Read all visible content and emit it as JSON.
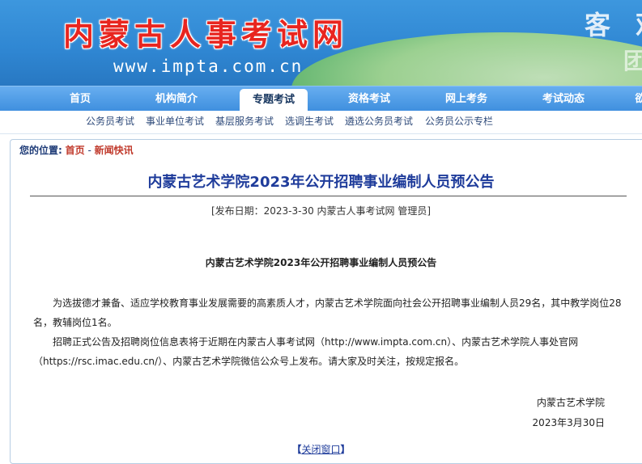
{
  "header": {
    "logo_text": "内蒙古人事考试网",
    "domain": "www.impta.com.cn",
    "slogan_line1": "客 观",
    "slogan_line2": "团"
  },
  "nav": {
    "items": [
      {
        "label": "首页",
        "active": false
      },
      {
        "label": "机构简介",
        "active": false
      },
      {
        "label": "专题考试",
        "active": true
      },
      {
        "label": "资格考试",
        "active": false
      },
      {
        "label": "网上考务",
        "active": false
      },
      {
        "label": "考试动态",
        "active": false
      },
      {
        "label": "欲",
        "active": false
      }
    ]
  },
  "subnav": {
    "items": [
      "公务员考试",
      "事业单位考试",
      "基层服务考试",
      "选调生考试",
      "遴选公务员考试",
      "公务员公示专栏"
    ]
  },
  "breadcrumb": {
    "label": "您的位置:",
    "home": "首页",
    "separator": " - ",
    "current": "新闻快讯"
  },
  "article": {
    "title": "内蒙古艺术学院2023年公开招聘事业编制人员预公告",
    "meta": "[发布日期：2023-3-30  内蒙古人事考试网  管理员]",
    "subtitle": "内蒙古艺术学院2023年公开招聘事业编制人员预公告",
    "paragraph1": "为选拔德才兼备、适应学校教育事业发展需要的高素质人才，内蒙古艺术学院面向社会公开招聘事业编制人员29名，其中教学岗位28名，教辅岗位1名。",
    "paragraph2": "招聘正式公告及招聘岗位信息表将于近期在内蒙古人事考试网（http://www.impta.com.cn）、内蒙古艺术学院人事处官网（https://rsc.imac.edu.cn/）、内蒙古艺术学院微信公众号上发布。请大家及时关注，按规定报名。",
    "signature": "内蒙古艺术学院",
    "date": "2023年3月30日"
  },
  "footer": {
    "close_bracket_left": "【",
    "close_label": "关闭窗口",
    "close_bracket_right": "】"
  },
  "colors": {
    "banner_blue": "#2f86d2",
    "nav_blue": "#3e8ede",
    "title_blue": "#1f3c9b",
    "logo_red": "#e8251f"
  }
}
